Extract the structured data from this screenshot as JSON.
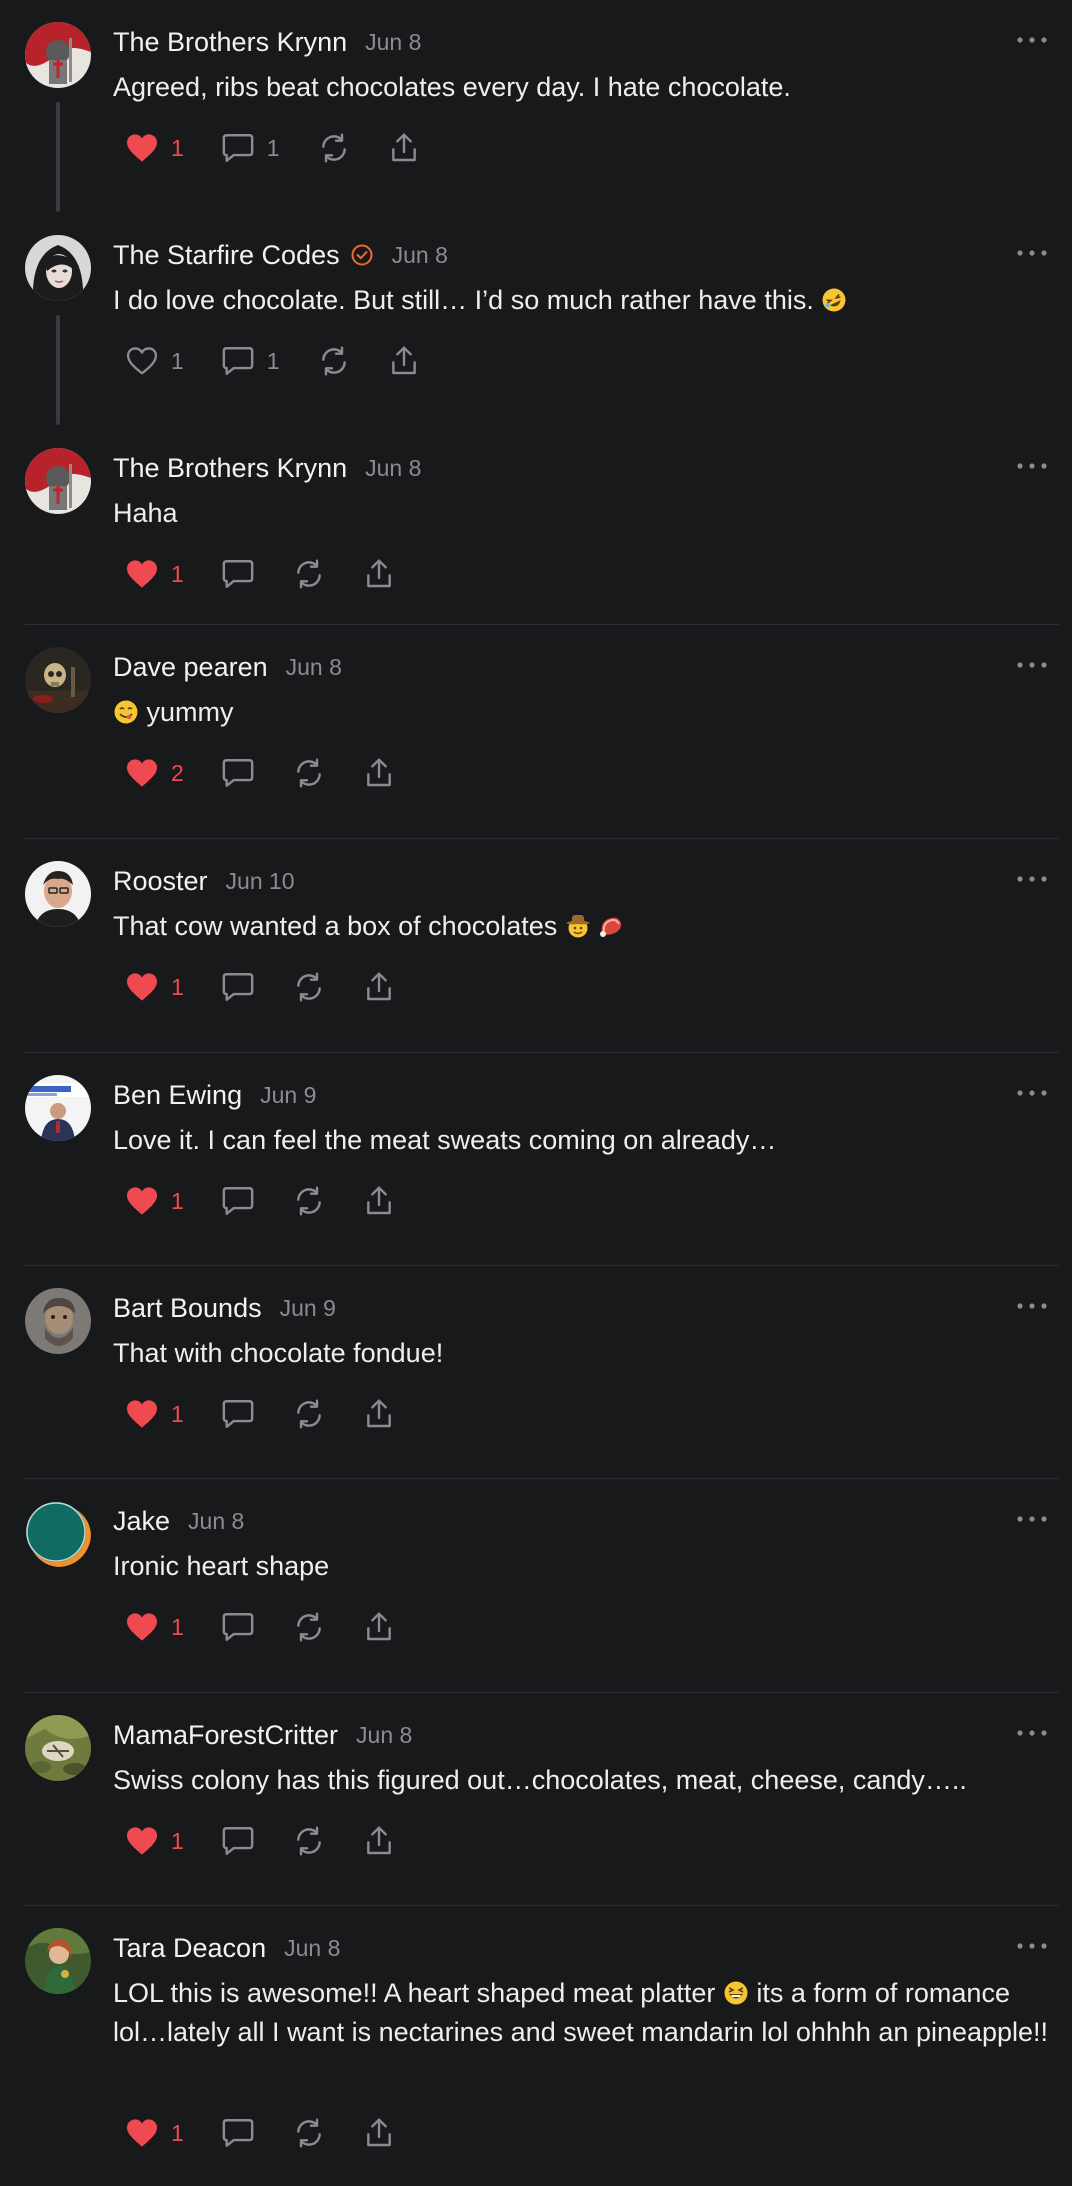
{
  "colors": {
    "background": "#18191b",
    "like_red": "#ee4a4f",
    "muted": "#8a8c90",
    "verified_orange": "#f06a2a"
  },
  "posts": [
    {
      "author": "The Brothers Krynn",
      "date": "Jun 8",
      "text": "Agreed, ribs beat chocolates every day. I hate chocolate.",
      "likes": "1",
      "liked": true,
      "replies": "1",
      "avatar": "crusader-knight",
      "verified": false
    },
    {
      "author": "The Starfire Codes",
      "date": "Jun 8",
      "text": "I do love chocolate. But still… I’d so much rather have this.",
      "emoji": "rolling-on-floor-laughing",
      "likes": "1",
      "liked": false,
      "replies": "1",
      "avatar": "woman-portrait",
      "verified": true
    },
    {
      "author": "The Brothers Krynn",
      "date": "Jun 8",
      "text": "Haha",
      "likes": "1",
      "liked": true,
      "avatar": "crusader-knight",
      "verified": false
    },
    {
      "author": "Dave pearen",
      "date": "Jun 8",
      "text": "yummy",
      "emoji_prefix": "face-savoring-food",
      "likes": "2",
      "liked": true,
      "avatar": "skull-still-life",
      "verified": false
    },
    {
      "author": "Rooster",
      "date": "Jun 10",
      "text": "That cow wanted a box of chocolates",
      "emoji": "cowboy-face and cut-of-meat",
      "likes": "1",
      "liked": true,
      "avatar": "man-portrait",
      "verified": false
    },
    {
      "author": "Ben Ewing",
      "date": "Jun 9",
      "text": "Love it. I can feel the meat sweats coming on already…",
      "likes": "1",
      "liked": true,
      "avatar": "speaker-at-banner",
      "verified": false
    },
    {
      "author": "Bart Bounds",
      "date": "Jun 9",
      "text": "That with chocolate fondue!",
      "likes": "1",
      "liked": true,
      "avatar": "man-bearded",
      "verified": false
    },
    {
      "author": "Jake",
      "date": "Jun 8",
      "text": "Ironic heart shape",
      "likes": "1",
      "liked": true,
      "avatar": "teal-orange-circle",
      "verified": false
    },
    {
      "author": "MamaForestCritter",
      "date": "Jun 8",
      "text": "Swiss colony has this figured out…chocolates, meat, cheese, candy…..",
      "likes": "1",
      "liked": true,
      "avatar": "moss-critter",
      "verified": false
    },
    {
      "author": "Tara Deacon",
      "date": "Jun 8",
      "text_before": "LOL this is awesome!! A heart shaped meat platter",
      "text_after": "its a form of romance lol…lately all I want is nectarines and sweet mandarin lol ohhhh an pineapple!!",
      "emoji": "grinning-squinting-face",
      "likes": "1",
      "liked": true,
      "avatar": "painted-woman",
      "verified": false
    }
  ]
}
